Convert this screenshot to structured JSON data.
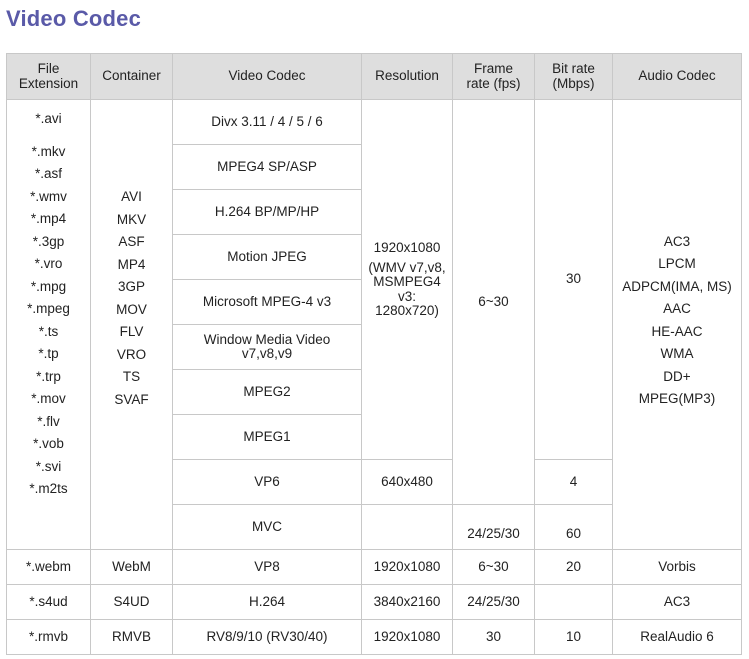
{
  "title": "Video Codec",
  "headers": {
    "ext": [
      "File",
      "Extension"
    ],
    "container": "Container",
    "codec": "Video Codec",
    "resolution": "Resolution",
    "fps": [
      "Frame",
      "rate (fps)"
    ],
    "bitrate": [
      "Bit rate",
      "(Mbps)"
    ],
    "audio": "Audio Codec"
  },
  "main_group": {
    "extensions": [
      "*.avi",
      "*.mkv",
      "*.asf",
      "*.wmv",
      "*.mp4",
      "*.3gp",
      "*.vro",
      "*.mpg",
      "*.mpeg",
      "*.ts",
      "*.tp",
      "*.trp",
      "*.mov",
      "*.flv",
      "*.vob",
      "*.svi",
      "*.m2ts"
    ],
    "containers": [
      "AVI",
      "MKV",
      "ASF",
      "MP4",
      "3GP",
      "MOV",
      "FLV",
      "VRO",
      "TS",
      "SVAF"
    ],
    "codecs": [
      "Divx 3.11 / 4 / 5 / 6",
      "MPEG4 SP/ASP",
      "H.264 BP/MP/HP",
      "Motion JPEG",
      "Microsoft MPEG-4 v3",
      "Window Media Video v7,v8,v9",
      "MPEG2",
      "MPEG1"
    ],
    "resolution_lines": [
      "1920x1080",
      "(WMV v7,v8,",
      "MSMPEG4",
      "v3:",
      "1280x720)"
    ],
    "fps": "6~30",
    "bitrate": "30",
    "audio": [
      "AC3",
      "LPCM",
      "ADPCM(IMA, MS)",
      "AAC",
      "HE-AAC",
      "WMA",
      "DD+",
      "MPEG(MP3)"
    ],
    "vp6": {
      "codec": "VP6",
      "resolution": "640x480",
      "bitrate": "4"
    },
    "mvc": {
      "codec": "MVC",
      "resolution": "",
      "fps": "24/25/30",
      "bitrate": "60"
    }
  },
  "rows": [
    {
      "ext": "*.webm",
      "container": "WebM",
      "codec": "VP8",
      "resolution": "1920x1080",
      "fps": "6~30",
      "bitrate": "20",
      "audio": "Vorbis"
    },
    {
      "ext": "*.s4ud",
      "container": "S4UD",
      "codec": "H.264",
      "resolution": "3840x2160",
      "fps": "24/25/30",
      "bitrate": "",
      "audio": "AC3"
    },
    {
      "ext": "*.rmvb",
      "container": "RMVB",
      "codec": "RV8/9/10 (RV30/40)",
      "resolution": "1920x1080",
      "fps": "30",
      "bitrate": "10",
      "audio": "RealAudio 6"
    }
  ]
}
